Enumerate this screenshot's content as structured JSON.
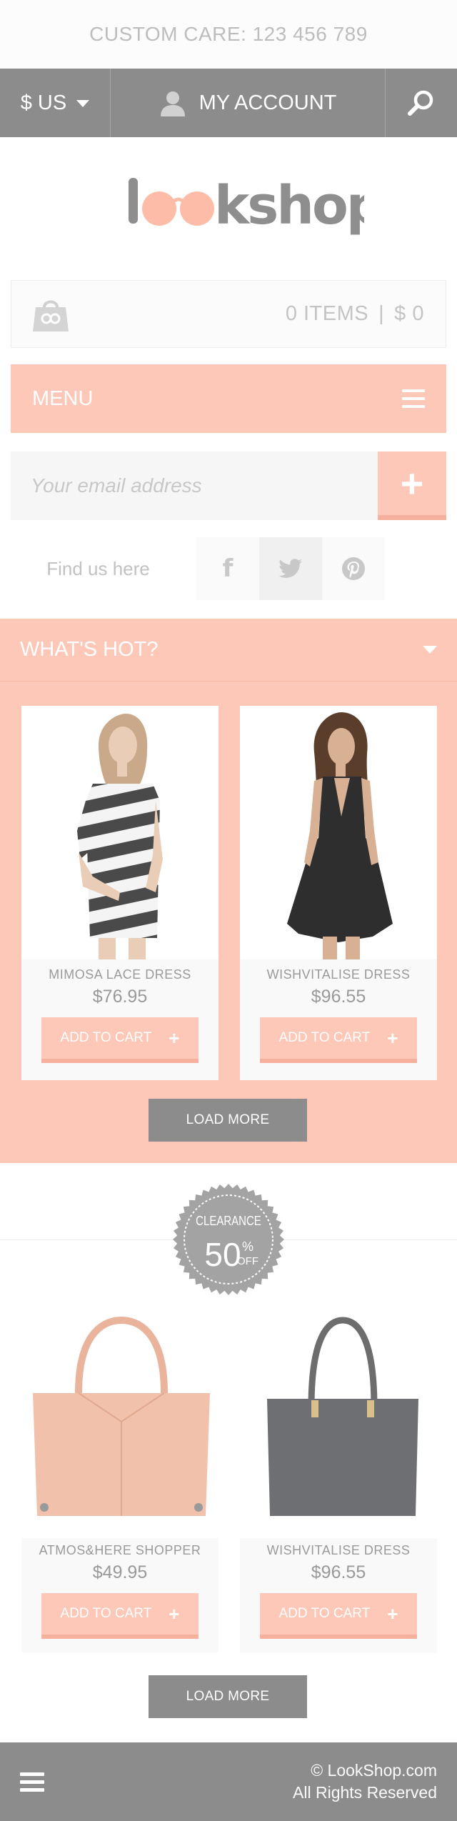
{
  "header": {
    "customer_care": "CUSTOM CARE: 123 456 789",
    "currency": "$ US",
    "account_label": "MY ACCOUNT",
    "logo_text": "lookshop"
  },
  "cart": {
    "items": "0 ITEMS",
    "separator": "|",
    "total": "$ 0"
  },
  "menu": {
    "label": "MENU"
  },
  "newsletter": {
    "placeholder": "Your email address",
    "button": "+"
  },
  "social": {
    "label": "Find us here",
    "icons": [
      "facebook-icon",
      "twitter-icon",
      "pinterest-icon"
    ],
    "facebook_glyph": "f"
  },
  "whats_hot": {
    "title": "WHAT'S HOT?",
    "products": [
      {
        "name": "MIMOSA LACE DRESS",
        "price": "$76.95",
        "button": "ADD TO CART"
      },
      {
        "name": "WISHVITALISE DRESS",
        "price": "$96.55",
        "button": "ADD TO CART"
      }
    ],
    "load_more": "LOAD MORE"
  },
  "clearance": {
    "badge_line1": "CLEARANCE",
    "badge_percent": "50",
    "badge_symbol": "%",
    "badge_off": "OFF",
    "products": [
      {
        "name": "ATMOS&HERE SHOPPER",
        "price": "$49.95",
        "button": "ADD TO CART"
      },
      {
        "name": "WISHVITALISE DRESS",
        "price": "$96.55",
        "button": "ADD TO CART"
      }
    ],
    "load_more": "LOAD MORE"
  },
  "footer": {
    "copyright": "© LookShop.com",
    "rights": "All Rights Reserved"
  },
  "colors": {
    "accent": "#fdc8b8",
    "dark_bar": "#8c8c8c",
    "text": "#9a9a9a"
  }
}
